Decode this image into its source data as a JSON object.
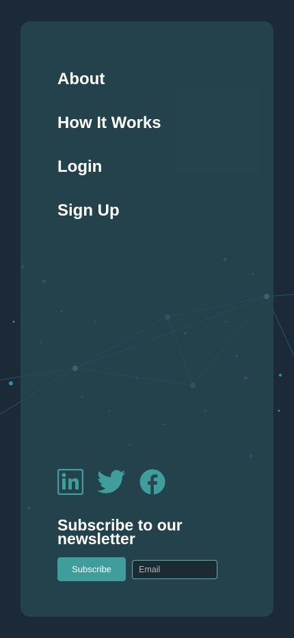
{
  "nav": {
    "items": [
      {
        "label": "About"
      },
      {
        "label": "How It Works"
      },
      {
        "label": "Login"
      },
      {
        "label": "Sign Up"
      }
    ]
  },
  "social": {
    "icons": [
      "linkedin-icon",
      "twitter-icon",
      "facebook-icon"
    ],
    "color": "#3f9e9c"
  },
  "newsletter": {
    "title": "Subscribe to our newsletter",
    "button_label": "Subscribe",
    "email_placeholder": "Email",
    "email_value": ""
  },
  "colors": {
    "background": "#1b2a36",
    "panel": "#264850",
    "accent": "#3f9e9c",
    "text": "#ffffff"
  }
}
